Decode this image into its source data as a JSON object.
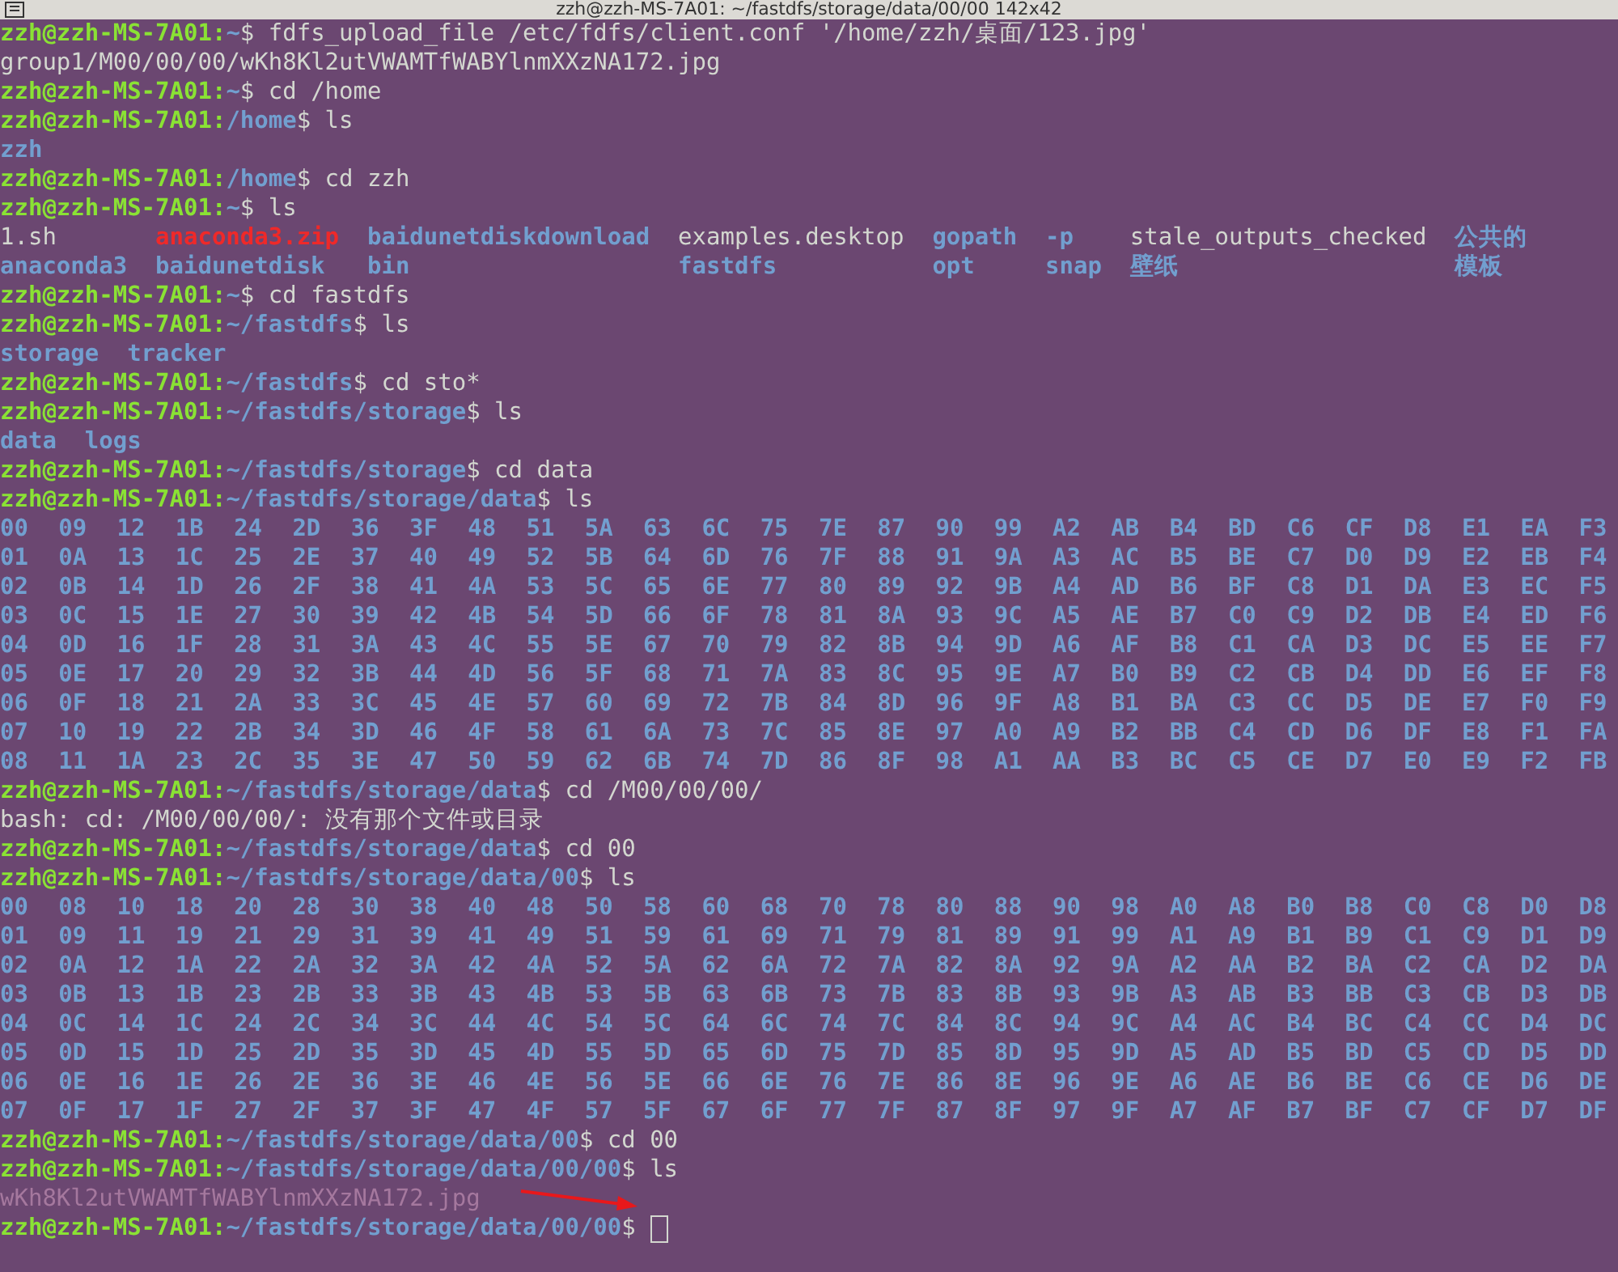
{
  "window": {
    "title": "zzh@zzh-MS-7A01: ~/fastdfs/storage/data/00/00 142x42"
  },
  "lines": [
    {
      "kind": "prompt",
      "host": "zzh@zzh-MS-7A01:",
      "path": "~",
      "sigil": "$",
      "command": "fdfs_upload_file /etc/fdfs/client.conf '/home/zzh/桌面/123.jpg'"
    },
    {
      "kind": "output",
      "text": "group1/M00/00/00/wKh8Kl2utVWAMTfWABYlnmXXzNA172.jpg"
    },
    {
      "kind": "prompt",
      "host": "zzh@zzh-MS-7A01:",
      "path": "~",
      "sigil": "$",
      "command": "cd /home"
    },
    {
      "kind": "prompt",
      "host": "zzh@zzh-MS-7A01:",
      "path": "/home",
      "sigil": "$",
      "command": "ls"
    },
    {
      "kind": "listing",
      "columns": [
        [
          {
            "name": "zzh",
            "kind": "dir"
          }
        ]
      ]
    },
    {
      "kind": "prompt",
      "host": "zzh@zzh-MS-7A01:",
      "path": "/home",
      "sigil": "$",
      "command": "cd zzh"
    },
    {
      "kind": "prompt",
      "host": "zzh@zzh-MS-7A01:",
      "path": "~",
      "sigil": "$",
      "command": "ls"
    },
    {
      "kind": "listing",
      "columns": [
        [
          {
            "name": "1.sh",
            "kind": "file"
          },
          {
            "name": "anaconda3",
            "kind": "dir"
          }
        ],
        [
          {
            "name": "anaconda3.zip",
            "kind": "archive"
          },
          {
            "name": "baidunetdisk",
            "kind": "dir"
          }
        ],
        [
          {
            "name": "baidunetdiskdownload",
            "kind": "dir"
          },
          {
            "name": "bin",
            "kind": "dir"
          }
        ],
        [
          {
            "name": "examples.desktop",
            "kind": "file"
          },
          {
            "name": "fastdfs",
            "kind": "dir"
          }
        ],
        [
          {
            "name": "gopath",
            "kind": "dir"
          },
          {
            "name": "opt",
            "kind": "dir"
          }
        ],
        [
          {
            "name": "-p",
            "kind": "dir"
          },
          {
            "name": "snap",
            "kind": "dir"
          }
        ],
        [
          {
            "name": "stale_outputs_checked",
            "kind": "file"
          },
          {
            "name": "壁纸",
            "kind": "dir"
          }
        ],
        [
          {
            "name": "公共的",
            "kind": "dir"
          },
          {
            "name": "模板",
            "kind": "dir"
          }
        ]
      ]
    },
    {
      "kind": "prompt",
      "host": "zzh@zzh-MS-7A01:",
      "path": "~",
      "sigil": "$",
      "command": "cd fastdfs"
    },
    {
      "kind": "prompt",
      "host": "zzh@zzh-MS-7A01:",
      "path": "~/fastdfs",
      "sigil": "$",
      "command": "ls"
    },
    {
      "kind": "listing",
      "columns": [
        [
          {
            "name": "storage",
            "kind": "dir"
          }
        ],
        [
          {
            "name": "tracker",
            "kind": "dir"
          }
        ]
      ]
    },
    {
      "kind": "prompt",
      "host": "zzh@zzh-MS-7A01:",
      "path": "~/fastdfs",
      "sigil": "$",
      "command": "cd sto*"
    },
    {
      "kind": "prompt",
      "host": "zzh@zzh-MS-7A01:",
      "path": "~/fastdfs/storage",
      "sigil": "$",
      "command": "ls"
    },
    {
      "kind": "listing",
      "columns": [
        [
          {
            "name": "data",
            "kind": "dir"
          }
        ],
        [
          {
            "name": "logs",
            "kind": "dir"
          }
        ]
      ]
    },
    {
      "kind": "prompt",
      "host": "zzh@zzh-MS-7A01:",
      "path": "~/fastdfs/storage",
      "sigil": "$",
      "command": "cd data"
    },
    {
      "kind": "prompt",
      "host": "zzh@zzh-MS-7A01:",
      "path": "~/fastdfs/storage/data",
      "sigil": "$",
      "command": "ls"
    },
    {
      "kind": "hexgrid",
      "rows": [
        [
          "00",
          "09",
          "12",
          "1B",
          "24",
          "2D",
          "36",
          "3F",
          "48",
          "51",
          "5A",
          "63",
          "6C",
          "75",
          "7E",
          "87",
          "90",
          "99",
          "A2",
          "AB",
          "B4",
          "BD",
          "C6",
          "CF",
          "D8",
          "E1",
          "EA",
          "F3"
        ],
        [
          "01",
          "0A",
          "13",
          "1C",
          "25",
          "2E",
          "37",
          "40",
          "49",
          "52",
          "5B",
          "64",
          "6D",
          "76",
          "7F",
          "88",
          "91",
          "9A",
          "A3",
          "AC",
          "B5",
          "BE",
          "C7",
          "D0",
          "D9",
          "E2",
          "EB",
          "F4"
        ],
        [
          "02",
          "0B",
          "14",
          "1D",
          "26",
          "2F",
          "38",
          "41",
          "4A",
          "53",
          "5C",
          "65",
          "6E",
          "77",
          "80",
          "89",
          "92",
          "9B",
          "A4",
          "AD",
          "B6",
          "BF",
          "C8",
          "D1",
          "DA",
          "E3",
          "EC",
          "F5"
        ],
        [
          "03",
          "0C",
          "15",
          "1E",
          "27",
          "30",
          "39",
          "42",
          "4B",
          "54",
          "5D",
          "66",
          "6F",
          "78",
          "81",
          "8A",
          "93",
          "9C",
          "A5",
          "AE",
          "B7",
          "C0",
          "C9",
          "D2",
          "DB",
          "E4",
          "ED",
          "F6"
        ],
        [
          "04",
          "0D",
          "16",
          "1F",
          "28",
          "31",
          "3A",
          "43",
          "4C",
          "55",
          "5E",
          "67",
          "70",
          "79",
          "82",
          "8B",
          "94",
          "9D",
          "A6",
          "AF",
          "B8",
          "C1",
          "CA",
          "D3",
          "DC",
          "E5",
          "EE",
          "F7"
        ],
        [
          "05",
          "0E",
          "17",
          "20",
          "29",
          "32",
          "3B",
          "44",
          "4D",
          "56",
          "5F",
          "68",
          "71",
          "7A",
          "83",
          "8C",
          "95",
          "9E",
          "A7",
          "B0",
          "B9",
          "C2",
          "CB",
          "D4",
          "DD",
          "E6",
          "EF",
          "F8"
        ],
        [
          "06",
          "0F",
          "18",
          "21",
          "2A",
          "33",
          "3C",
          "45",
          "4E",
          "57",
          "60",
          "69",
          "72",
          "7B",
          "84",
          "8D",
          "96",
          "9F",
          "A8",
          "B1",
          "BA",
          "C3",
          "CC",
          "D5",
          "DE",
          "E7",
          "F0",
          "F9"
        ],
        [
          "07",
          "10",
          "19",
          "22",
          "2B",
          "34",
          "3D",
          "46",
          "4F",
          "58",
          "61",
          "6A",
          "73",
          "7C",
          "85",
          "8E",
          "97",
          "A0",
          "A9",
          "B2",
          "BB",
          "C4",
          "CD",
          "D6",
          "DF",
          "E8",
          "F1",
          "FA"
        ],
        [
          "08",
          "11",
          "1A",
          "23",
          "2C",
          "35",
          "3E",
          "47",
          "50",
          "59",
          "62",
          "6B",
          "74",
          "7D",
          "86",
          "8F",
          "98",
          "A1",
          "AA",
          "B3",
          "BC",
          "C5",
          "CE",
          "D7",
          "E0",
          "E9",
          "F2",
          "FB"
        ]
      ]
    },
    {
      "kind": "prompt",
      "host": "zzh@zzh-MS-7A01:",
      "path": "~/fastdfs/storage/data",
      "sigil": "$",
      "command": "cd /M00/00/00/"
    },
    {
      "kind": "output",
      "text": "bash: cd: /M00/00/00/: 没有那个文件或目录"
    },
    {
      "kind": "prompt",
      "host": "zzh@zzh-MS-7A01:",
      "path": "~/fastdfs/storage/data",
      "sigil": "$",
      "command": "cd 00"
    },
    {
      "kind": "prompt",
      "host": "zzh@zzh-MS-7A01:",
      "path": "~/fastdfs/storage/data/00",
      "sigil": "$",
      "command": "ls"
    },
    {
      "kind": "hexgrid",
      "rows": [
        [
          "00",
          "08",
          "10",
          "18",
          "20",
          "28",
          "30",
          "38",
          "40",
          "48",
          "50",
          "58",
          "60",
          "68",
          "70",
          "78",
          "80",
          "88",
          "90",
          "98",
          "A0",
          "A8",
          "B0",
          "B8",
          "C0",
          "C8",
          "D0",
          "D8"
        ],
        [
          "01",
          "09",
          "11",
          "19",
          "21",
          "29",
          "31",
          "39",
          "41",
          "49",
          "51",
          "59",
          "61",
          "69",
          "71",
          "79",
          "81",
          "89",
          "91",
          "99",
          "A1",
          "A9",
          "B1",
          "B9",
          "C1",
          "C9",
          "D1",
          "D9"
        ],
        [
          "02",
          "0A",
          "12",
          "1A",
          "22",
          "2A",
          "32",
          "3A",
          "42",
          "4A",
          "52",
          "5A",
          "62",
          "6A",
          "72",
          "7A",
          "82",
          "8A",
          "92",
          "9A",
          "A2",
          "AA",
          "B2",
          "BA",
          "C2",
          "CA",
          "D2",
          "DA"
        ],
        [
          "03",
          "0B",
          "13",
          "1B",
          "23",
          "2B",
          "33",
          "3B",
          "43",
          "4B",
          "53",
          "5B",
          "63",
          "6B",
          "73",
          "7B",
          "83",
          "8B",
          "93",
          "9B",
          "A3",
          "AB",
          "B3",
          "BB",
          "C3",
          "CB",
          "D3",
          "DB"
        ],
        [
          "04",
          "0C",
          "14",
          "1C",
          "24",
          "2C",
          "34",
          "3C",
          "44",
          "4C",
          "54",
          "5C",
          "64",
          "6C",
          "74",
          "7C",
          "84",
          "8C",
          "94",
          "9C",
          "A4",
          "AC",
          "B4",
          "BC",
          "C4",
          "CC",
          "D4",
          "DC"
        ],
        [
          "05",
          "0D",
          "15",
          "1D",
          "25",
          "2D",
          "35",
          "3D",
          "45",
          "4D",
          "55",
          "5D",
          "65",
          "6D",
          "75",
          "7D",
          "85",
          "8D",
          "95",
          "9D",
          "A5",
          "AD",
          "B5",
          "BD",
          "C5",
          "CD",
          "D5",
          "DD"
        ],
        [
          "06",
          "0E",
          "16",
          "1E",
          "26",
          "2E",
          "36",
          "3E",
          "46",
          "4E",
          "56",
          "5E",
          "66",
          "6E",
          "76",
          "7E",
          "86",
          "8E",
          "96",
          "9E",
          "A6",
          "AE",
          "B6",
          "BE",
          "C6",
          "CE",
          "D6",
          "DE"
        ],
        [
          "07",
          "0F",
          "17",
          "1F",
          "27",
          "2F",
          "37",
          "3F",
          "47",
          "4F",
          "57",
          "5F",
          "67",
          "6F",
          "77",
          "7F",
          "87",
          "8F",
          "97",
          "9F",
          "A7",
          "AF",
          "B7",
          "BF",
          "C7",
          "CF",
          "D7",
          "DF"
        ]
      ]
    },
    {
      "kind": "prompt",
      "host": "zzh@zzh-MS-7A01:",
      "path": "~/fastdfs/storage/data/00",
      "sigil": "$",
      "command": "cd 00"
    },
    {
      "kind": "prompt",
      "host": "zzh@zzh-MS-7A01:",
      "path": "~/fastdfs/storage/data/00/00",
      "sigil": "$",
      "command": "ls"
    },
    {
      "kind": "listing",
      "arrow": true,
      "columns": [
        [
          {
            "name": "wKh8Kl2utVWAMTfWABYlnmXXzNA172.jpg",
            "kind": "image"
          }
        ]
      ]
    },
    {
      "kind": "prompt",
      "host": "zzh@zzh-MS-7A01:",
      "path": "~/fastdfs/storage/data/00/00",
      "sigil": "$",
      "cursor": true
    }
  ]
}
